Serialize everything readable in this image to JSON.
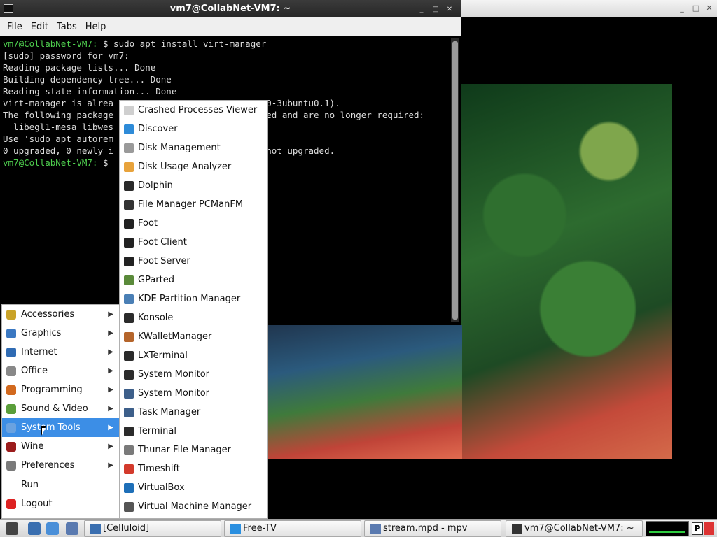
{
  "terminal": {
    "title": "vm7@CollabNet-VM7: ~",
    "menu": [
      "File",
      "Edit",
      "Tabs",
      "Help"
    ],
    "lines": [
      {
        "prompt": "vm7@CollabNet-VM7:",
        "text": " $ sudo apt install virt-manager"
      },
      {
        "prompt": "",
        "text": "[sudo] password for vm7:"
      },
      {
        "prompt": "",
        "text": "Reading package lists... Done"
      },
      {
        "prompt": "",
        "text": "Building dependency tree... Done"
      },
      {
        "prompt": "",
        "text": "Reading state information... Done"
      },
      {
        "prompt": "",
        "text": "virt-manager is alrea                           1.0-3ubuntu0.1)."
      },
      {
        "prompt": "",
        "text": "The following package                           lled and are no longer required:"
      },
      {
        "prompt": "",
        "text": "  libegl1-mesa libwes"
      },
      {
        "prompt": "",
        "text": "Use 'sudo apt autorem"
      },
      {
        "prompt": "",
        "text": "0 upgraded, 0 newly i                           0 not upgraded."
      },
      {
        "prompt": "vm7@CollabNet-VM7:",
        "text": " $ "
      }
    ]
  },
  "main_menu": [
    {
      "label": "Accessories",
      "icon": "accessories-icon",
      "color": "#c9a227",
      "submenu": true
    },
    {
      "label": "Graphics",
      "icon": "graphics-icon",
      "color": "#3a78c2",
      "submenu": true
    },
    {
      "label": "Internet",
      "icon": "internet-icon",
      "color": "#2f6bb3",
      "submenu": true
    },
    {
      "label": "Office",
      "icon": "office-icon",
      "color": "#888888",
      "submenu": true
    },
    {
      "label": "Programming",
      "icon": "programming-icon",
      "color": "#d2691e",
      "submenu": true
    },
    {
      "label": "Sound & Video",
      "icon": "sound-video-icon",
      "color": "#5a9e3a",
      "submenu": true
    },
    {
      "label": "System Tools",
      "icon": "system-tools-icon",
      "color": "#6aa2e0",
      "submenu": true,
      "active": true
    },
    {
      "label": "Wine",
      "icon": "wine-icon",
      "color": "#9b1c1c",
      "submenu": true
    },
    {
      "label": "Preferences",
      "icon": "preferences-icon",
      "color": "#7a7a7a",
      "submenu": true
    },
    {
      "label": "Run",
      "icon": "",
      "color": "",
      "submenu": false
    },
    {
      "label": "Logout",
      "icon": "logout-icon",
      "color": "#d22",
      "submenu": false
    }
  ],
  "system_tools": [
    {
      "label": "Crashed Processes Viewer",
      "icon": "crash-viewer-icon",
      "color": "#cfcfcf"
    },
    {
      "label": "Discover",
      "icon": "discover-icon",
      "color": "#2e8bd8"
    },
    {
      "label": "Disk Management",
      "icon": "disk-management-icon",
      "color": "#9a9a9a"
    },
    {
      "label": "Disk Usage Analyzer",
      "icon": "disk-usage-analyzer-icon",
      "color": "#e8a33c"
    },
    {
      "label": "Dolphin",
      "icon": "dolphin-icon",
      "color": "#2a2a2a"
    },
    {
      "label": "File Manager PCManFM",
      "icon": "pcmanfm-icon",
      "color": "#333333"
    },
    {
      "label": "Foot",
      "icon": "foot-icon",
      "color": "#222222"
    },
    {
      "label": "Foot Client",
      "icon": "foot-client-icon",
      "color": "#222222"
    },
    {
      "label": "Foot Server",
      "icon": "foot-server-icon",
      "color": "#222222"
    },
    {
      "label": "GParted",
      "icon": "gparted-icon",
      "color": "#5a8a3a"
    },
    {
      "label": "KDE Partition Manager",
      "icon": "kde-partition-manager-icon",
      "color": "#4a7fb5"
    },
    {
      "label": "Konsole",
      "icon": "konsole-icon",
      "color": "#2b2b2b"
    },
    {
      "label": "KWalletManager",
      "icon": "kwalletmanager-icon",
      "color": "#b5652b"
    },
    {
      "label": "LXTerminal",
      "icon": "lxterminal-icon",
      "color": "#2b2b2b"
    },
    {
      "label": "System Monitor",
      "icon": "system-monitor-icon",
      "color": "#2b2b2b"
    },
    {
      "label": "System Monitor",
      "icon": "system-monitor-icon",
      "color": "#3d5f8a"
    },
    {
      "label": "Task Manager",
      "icon": "task-manager-icon",
      "color": "#3d5f8a"
    },
    {
      "label": "Terminal",
      "icon": "terminal-icon",
      "color": "#2b2b2b"
    },
    {
      "label": "Thunar File Manager",
      "icon": "thunar-icon",
      "color": "#7a7a7a"
    },
    {
      "label": "Timeshift",
      "icon": "timeshift-icon",
      "color": "#d33a2c"
    },
    {
      "label": "VirtualBox",
      "icon": "virtualbox-icon",
      "color": "#1e6fb8"
    },
    {
      "label": "Virtual Machine Manager",
      "icon": "virt-manager-icon",
      "color": "#555555"
    }
  ],
  "taskbar": {
    "launchers": [
      {
        "icon": "start-menu-icon",
        "color": "#444444"
      },
      {
        "icon": "show-desktop-icon",
        "color": "#3a6fb0"
      },
      {
        "icon": "browser-icon",
        "color": "#4a8fd8"
      },
      {
        "icon": "window-switcher-icon",
        "color": "#5a7ab0"
      }
    ],
    "tasks": [
      {
        "label": "[Celluloid]",
        "icon": "celluloid-icon",
        "color": "#3a6fb0"
      },
      {
        "label": "Free-TV",
        "icon": "free-tv-icon",
        "color": "#2a8fe0"
      },
      {
        "label": "stream.mpd - mpv",
        "icon": "mpv-icon",
        "color": "#5a7ab0"
      },
      {
        "label": "vm7@CollabNet-VM7: ~",
        "icon": "terminal-task-icon",
        "color": "#333333"
      }
    ],
    "tray_label": "P"
  }
}
